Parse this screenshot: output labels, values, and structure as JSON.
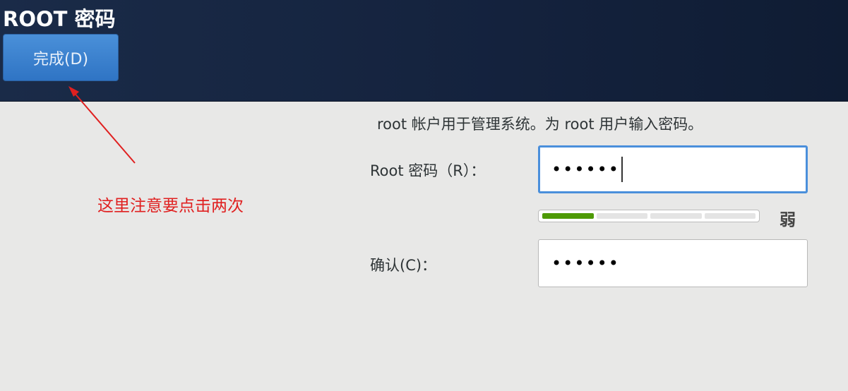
{
  "header": {
    "title": "ROOT 密码",
    "done_label": "完成(D)"
  },
  "form": {
    "intro": "root 帐户用于管理系统。为 root 用户输入密码。",
    "root_label": "Root 密码（R）：",
    "root_value": "••••••",
    "strength_fraction": 0.25,
    "strength_label": "弱",
    "strength_color": "#4e9a06",
    "confirm_label": "确认(C)：",
    "confirm_value": "••••••"
  },
  "annotation": {
    "note": "这里注意要点击两次",
    "color": "#e02020"
  }
}
